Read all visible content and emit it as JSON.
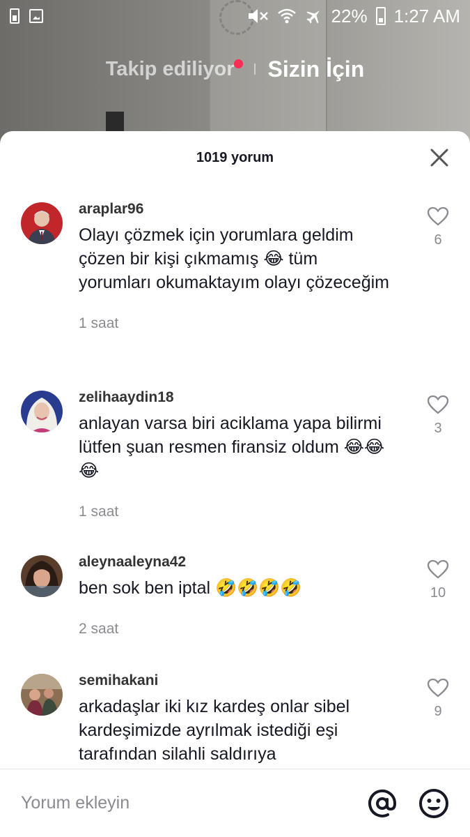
{
  "status_bar": {
    "battery_percent": "22%",
    "time": "1:27 AM"
  },
  "top_tabs": {
    "following": "Takip ediliyor",
    "for_you": "Sizin İçin"
  },
  "sheet": {
    "title": "1019 yorum"
  },
  "comments": [
    {
      "username": "araplar96",
      "text": "Olayı çözmek için yorumlara geldim çözen bir kişi çıkmamış 😂 tüm yorumları okumaktayım olayı çözeceğim",
      "time": "1 saat",
      "likes": "6"
    },
    {
      "username": "zelihaaydin18",
      "text": "anlayan varsa biri aciklama yapa bilirmi lütfen şuan resmen firansiz oldum 😂😂😂",
      "time": "1 saat",
      "likes": "3"
    },
    {
      "username": "aleynaaleyna42",
      "text": "ben sok ben iptal 🤣🤣🤣🤣",
      "time": "2 saat",
      "likes": "10"
    },
    {
      "username": "semihakani",
      "text": "arkadaşlar iki kız kardeş onlar sibel kardeşimizde ayrılmak istediği eşi tarafından silahli saldırıya",
      "time": "",
      "likes": "9"
    }
  ],
  "input": {
    "placeholder": "Yorum ekleyin"
  },
  "colors": {
    "accent_dot": "#fe2c55",
    "text_primary": "#161823",
    "text_secondary": "#8a8b91"
  },
  "icons": [
    "battery-saver-icon",
    "gallery-icon",
    "mute-icon",
    "wifi-icon",
    "airplane-icon",
    "battery-icon",
    "close-icon",
    "heart-icon",
    "at-icon",
    "emoji-icon"
  ]
}
